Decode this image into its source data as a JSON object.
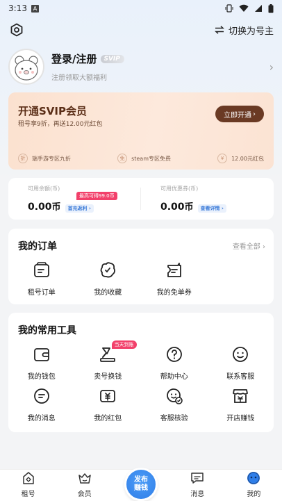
{
  "status": {
    "time": "3:13"
  },
  "topbar": {
    "switch_label": "切换为号主"
  },
  "profile": {
    "login": "登录/注册",
    "badge": "SVIP",
    "subtitle": "注册领取大额福利"
  },
  "vip": {
    "title": "开通SVIP会员",
    "subtitle": "租号享9折，再送12.00元红包",
    "button": "立即开通",
    "perks": [
      "端手游专区九折",
      "steam专区免费",
      "12.00元红包"
    ]
  },
  "balance": {
    "left_label": "可用余额(币)",
    "left_value": "0.00",
    "left_unit": "币",
    "left_tag": "最高可得99.0币",
    "left_link": "首充返利",
    "right_label": "可用优惠券(币)",
    "right_value": "0.00",
    "right_unit": "币",
    "right_link": "查看详情"
  },
  "orders": {
    "title": "我的订单",
    "more": "查看全部",
    "items": [
      {
        "label": "租号订单",
        "icon": "order-icon"
      },
      {
        "label": "我的收藏",
        "icon": "favorite-icon"
      },
      {
        "label": "我的免单券",
        "icon": "coupon-icon"
      }
    ]
  },
  "tools": {
    "title": "我的常用工具",
    "hot_tag": "当天到账",
    "items": [
      {
        "label": "我的钱包",
        "icon": "wallet-icon"
      },
      {
        "label": "卖号换钱",
        "icon": "sell-icon"
      },
      {
        "label": "帮助中心",
        "icon": "help-icon"
      },
      {
        "label": "联系客服",
        "icon": "service-icon"
      },
      {
        "label": "我的消息",
        "icon": "message-icon"
      },
      {
        "label": "我的红包",
        "icon": "redpacket-icon"
      },
      {
        "label": "客服核验",
        "icon": "verify-icon"
      },
      {
        "label": "开店赚钱",
        "icon": "shop-icon"
      }
    ]
  },
  "tabbar": {
    "items": [
      "租号",
      "会员",
      "消息",
      "我的"
    ],
    "publish_line1": "发布",
    "publish_line2": "赚钱"
  }
}
